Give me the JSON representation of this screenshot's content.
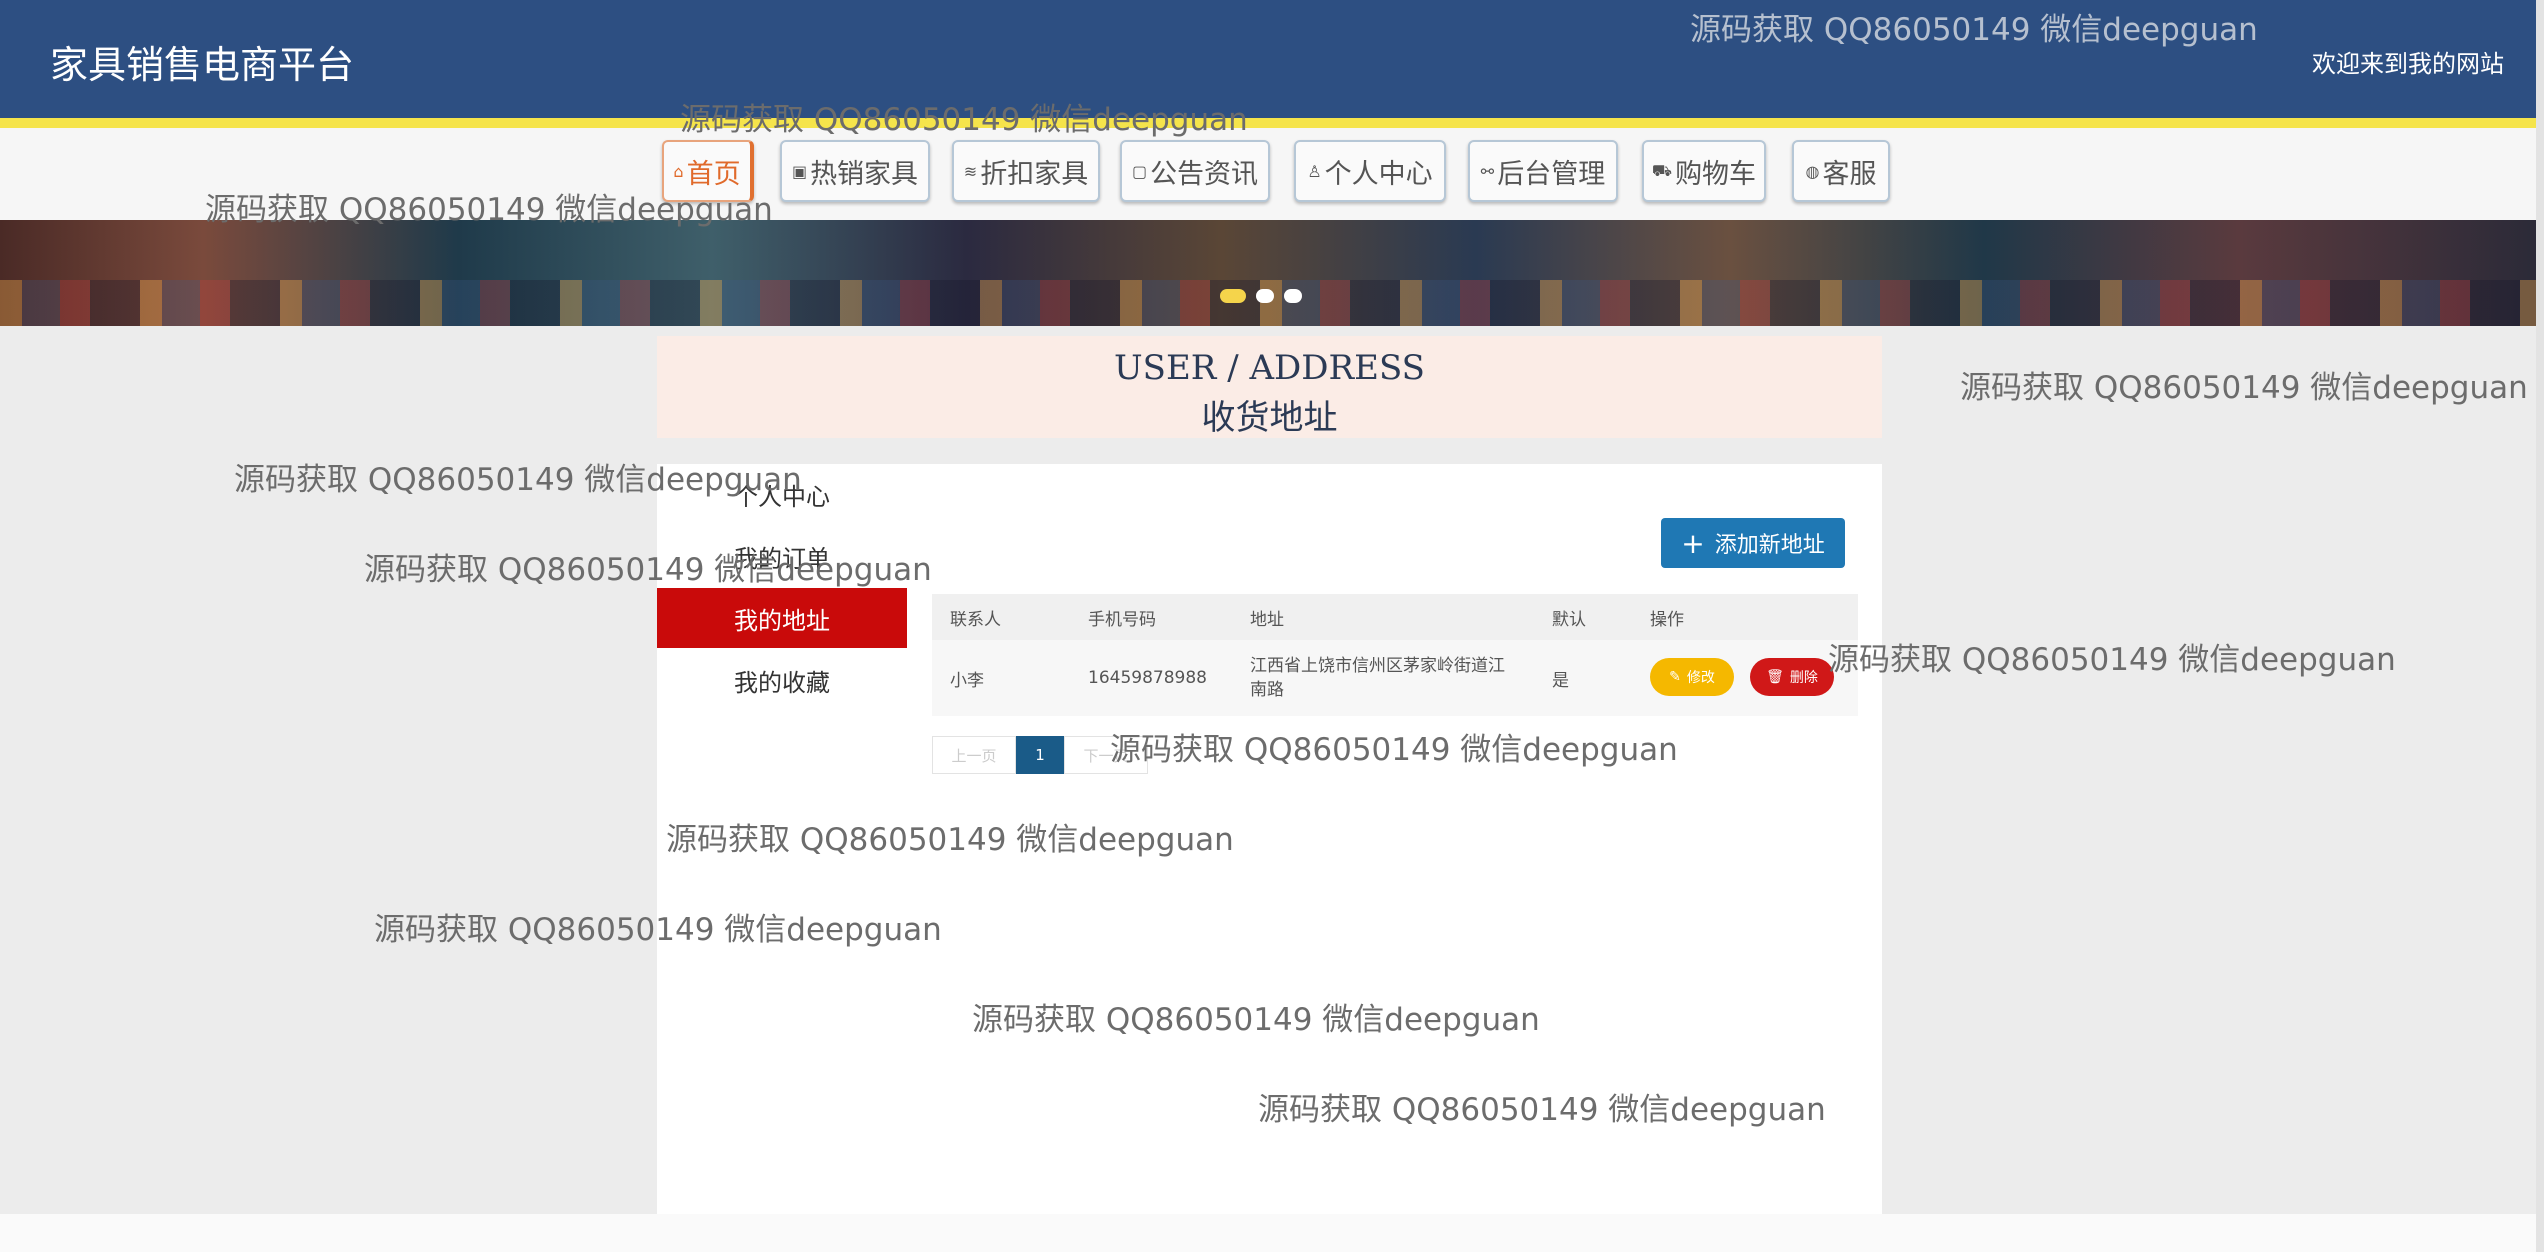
{
  "header": {
    "brand": "家具销售电商平台",
    "welcome": "欢迎来到我的网站"
  },
  "nav": [
    {
      "icon": "home-icon",
      "glyph": "⌂",
      "label": "首页"
    },
    {
      "icon": "gift-icon",
      "glyph": "▣",
      "label": "热销家具"
    },
    {
      "icon": "layers-icon",
      "glyph": "≋",
      "label": "折扣家具"
    },
    {
      "icon": "note-icon",
      "glyph": "▢",
      "label": "公告资讯"
    },
    {
      "icon": "user-icon",
      "glyph": "♙",
      "label": "个人中心"
    },
    {
      "icon": "link-icon",
      "glyph": "⚯",
      "label": "后台管理"
    },
    {
      "icon": "cart-icon",
      "glyph": "⛟",
      "label": "购物车"
    },
    {
      "icon": "chat-icon",
      "glyph": "◍",
      "label": "客服"
    }
  ],
  "title": {
    "en": "USER / ADDRESS",
    "cn": "收货地址"
  },
  "sidebar": [
    {
      "label": "个人中心"
    },
    {
      "label": "我的订单"
    },
    {
      "label": "我的地址"
    },
    {
      "label": "我的收藏"
    }
  ],
  "add_button": "添加新地址",
  "table": {
    "headers": [
      "联系人",
      "手机号码",
      "地址",
      "默认",
      "操作"
    ],
    "rows": [
      {
        "name": "小李",
        "phone": "16459878988",
        "address": "江西省上饶市信州区茅家岭街道江南路",
        "default": "是"
      }
    ],
    "edit_label": "修改",
    "delete_label": "删除"
  },
  "pager": {
    "prev": "上一页",
    "current": "1",
    "next": "下一页"
  },
  "watermark": "源码获取 QQ86050149 微信deepguan",
  "colors": {
    "header": "#2d4f82",
    "accent": "#c90a0a",
    "add_button": "#1f78b4",
    "edit": "#f5b800",
    "delete": "#d01818"
  }
}
